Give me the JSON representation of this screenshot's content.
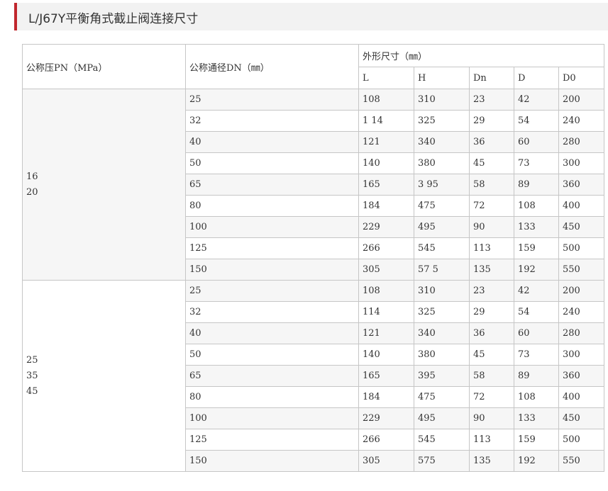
{
  "page": {
    "title": "L/J67Y平衡角式截止阀连接尺寸"
  },
  "table": {
    "headers": {
      "pn": "公称压PN（MPa）",
      "dn": "公称通径DN（㎜）",
      "dims": "外形尺寸（㎜）",
      "sub": [
        "L",
        "H",
        "Dn",
        "D",
        "D0"
      ]
    },
    "groups": [
      {
        "pn_values": [
          "16",
          "20"
        ],
        "rows": [
          [
            "25",
            "108",
            "310",
            "23",
            "42",
            "200"
          ],
          [
            "32",
            "1 14",
            "325",
            "29",
            "54",
            "240"
          ],
          [
            "40",
            "121",
            "340",
            "36",
            "60",
            "280"
          ],
          [
            "50",
            "140",
            "380",
            "45",
            "73",
            "300"
          ],
          [
            "65",
            "165",
            "3 95",
            "58",
            "89",
            "360"
          ],
          [
            "80",
            "184",
            "475",
            "72",
            "108",
            "400"
          ],
          [
            "100",
            "229",
            "495",
            "90",
            "133",
            "450"
          ],
          [
            "125",
            "266",
            "545",
            "113",
            "159",
            "500"
          ],
          [
            "150",
            "305",
            "57 5",
            "135",
            "192",
            "550"
          ]
        ]
      },
      {
        "pn_values": [
          "25",
          "35",
          "45"
        ],
        "rows": [
          [
            "25",
            "108",
            "310",
            "23",
            "42",
            "200"
          ],
          [
            "32",
            "114",
            "325",
            "29",
            "54",
            "240"
          ],
          [
            "40",
            "121",
            "340",
            "36",
            "60",
            "280"
          ],
          [
            "50",
            "140",
            "380",
            "45",
            "73",
            "300"
          ],
          [
            "65",
            "165",
            "395",
            "58",
            "89",
            "360"
          ],
          [
            "80",
            "184",
            "475",
            "72",
            "108",
            "400"
          ],
          [
            "100",
            "229",
            "495",
            "90",
            "133",
            "450"
          ],
          [
            "125",
            "266",
            "545",
            "113",
            "159",
            "500"
          ],
          [
            "150",
            "305",
            "575",
            "135",
            "192",
            "550"
          ]
        ]
      }
    ]
  }
}
